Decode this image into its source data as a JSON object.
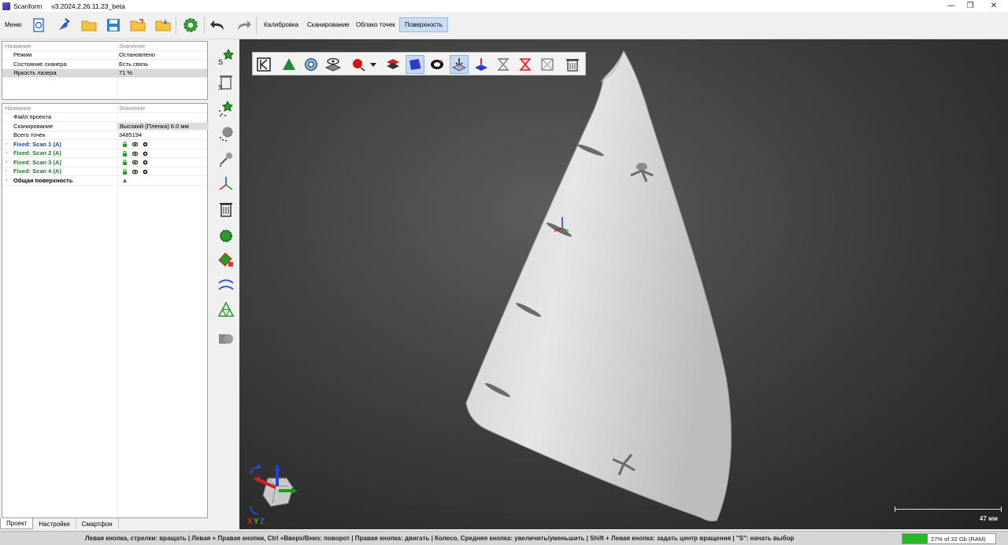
{
  "app": {
    "name": "Scanform",
    "version": "v3.2024.2.26.11.23_beta"
  },
  "toolbar": {
    "menu_label": "Меню",
    "tabs": [
      "Калибровка",
      "Сканирование",
      "Облако точек",
      "Поверхность"
    ],
    "active_tab": "Поверхность"
  },
  "scanner_panel": {
    "header": {
      "name": "Название",
      "value": "Значение"
    },
    "rows": [
      {
        "label": "Режим",
        "value": "Остановлено"
      },
      {
        "label": "Состояние сканера",
        "value": "Есть связь"
      },
      {
        "label": "Яркость лазера",
        "value": "71 %"
      }
    ]
  },
  "project_panel": {
    "header": {
      "name": "Название",
      "value": "Значение"
    },
    "rows": [
      {
        "label": "Файл проекта",
        "value": ""
      },
      {
        "label": "Сканирование",
        "value": "Высокий (Пленка)  6.0 мм"
      },
      {
        "label": "Всего точек",
        "value": "3485194"
      }
    ],
    "scans": [
      {
        "label": "Fixed: Scan 1 (A)",
        "color": "blue"
      },
      {
        "label": "Fixed: Scan 2 (A)",
        "color": "green"
      },
      {
        "label": "Fixed: Scan 3 (A)",
        "color": "green"
      },
      {
        "label": "Fixed: Scan 4 (A)",
        "color": "green"
      }
    ],
    "surface": {
      "label": "Общая поверхность"
    }
  },
  "bottom_tabs": [
    "Проект",
    "Настройки",
    "Смартфон"
  ],
  "viewport": {
    "scale_label": "47 мм",
    "gizmo_labels": {
      "x": "X",
      "y": "Y",
      "z": "Z"
    }
  },
  "status": {
    "hint": "Левая кнопка, стрелки: вращать  |  Левая + Правая кнопки, Ctrl +Вверх/Вниз: поворот  |  Правая кнопка: двигать  |  Колесо, Средняя кнопка: увеличить/уменьшить  |  Shift + Левая кнопка: задать центр вращения  |  \"S\": начать выбор",
    "ram_text": "27% of 32 Gb (RAM)",
    "ram_fraction": 0.27
  },
  "colors": {
    "accent": "#c9def5",
    "ram_fill": "#27b727",
    "viewport_bg": "#3a3a3a"
  }
}
